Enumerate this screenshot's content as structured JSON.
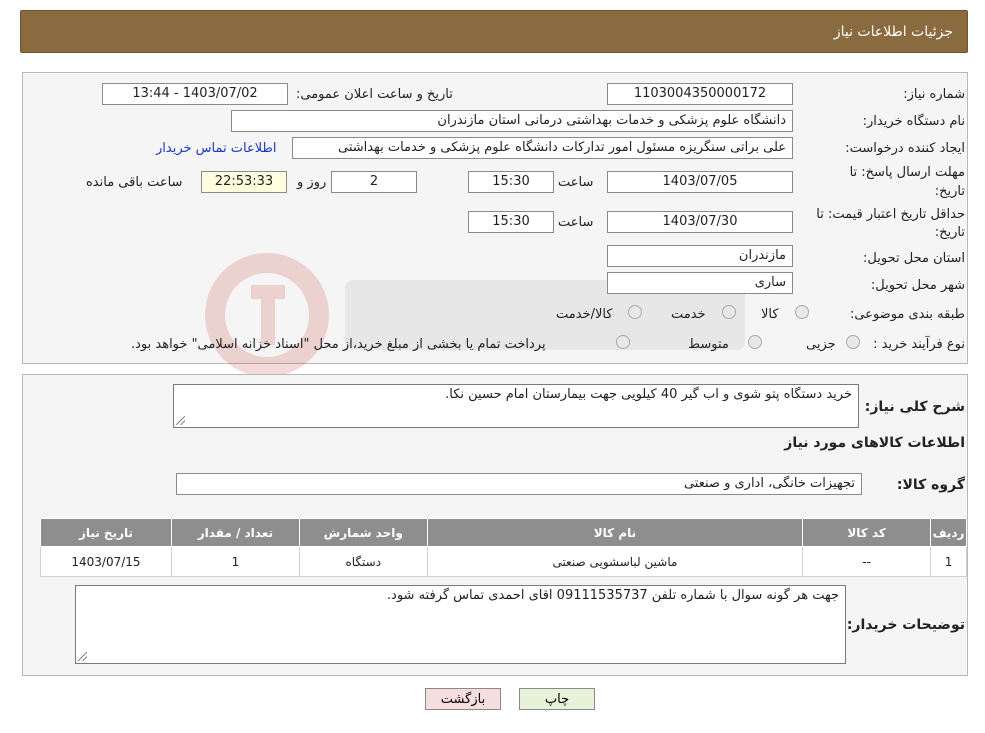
{
  "header": {
    "title": "جزئیات اطلاعات نیاز"
  },
  "form": {
    "need_number_label": "شماره نیاز:",
    "need_number": "1103004350000172",
    "announce_label": "تاریخ و ساعت اعلان عمومی:",
    "announce_value": "1403/07/02 - 13:44",
    "buyer_org_label": "نام دستگاه خریدار:",
    "buyer_org": "دانشگاه علوم پزشکی و خدمات بهداشتی  درمانی استان مازندران",
    "creator_label": "ایجاد کننده درخواست:",
    "creator": "علی براتی سنگریزه مسئول امور تدارکات دانشگاه علوم پزشکی و خدمات بهداشتی",
    "contact_link": "اطلاعات تماس خریدار",
    "deadline_label_1": "مهلت ارسال پاسخ: تا",
    "deadline_label_2": "تاریخ:",
    "deadline_date": "1403/07/05",
    "time_label": "ساعت",
    "deadline_time": "15:30",
    "days_value": "2",
    "days_label": "روز و",
    "remaining_time": "22:53:33",
    "remaining_label": "ساعت باقی مانده",
    "validity_label_1": "حداقل تاریخ اعتبار قیمت: تا",
    "validity_label_2": "تاریخ:",
    "validity_date": "1403/07/30",
    "validity_time": "15:30",
    "province_label": "استان محل تحویل:",
    "province": "مازندران",
    "city_label": "شهر محل تحویل:",
    "city": "ساری",
    "category_label": "طبقه بندی موضوعی:",
    "category_options": [
      "کالا",
      "خدمت",
      "کالا/خدمت"
    ],
    "process_label": "نوع فرآیند خرید :",
    "process_options": [
      "جزیی",
      "متوسط"
    ],
    "payment_note": "پرداخت تمام یا بخشی از مبلغ خرید،از محل \"اسناد خزانه اسلامی\" خواهد بود."
  },
  "details": {
    "summary_label": "شرح کلی نیاز:",
    "summary": "خرید دستگاه پتو شوی و اب گیر 40 کیلویی جهت بیمارستان امام حسین نکا.",
    "goods_info_title": "اطلاعات کالاهای مورد نیاز",
    "goods_group_label": "گروه کالا:",
    "goods_group": "تجهیزات خانگی، اداری و صنعتی",
    "table": {
      "headers": [
        "ردیف",
        "کد کالا",
        "نام کالا",
        "واحد شمارش",
        "تعداد / مقدار",
        "تاریخ نیاز"
      ],
      "rows": [
        [
          "1",
          "--",
          "ماشین لباسشویی صنعتی",
          "دستگاه",
          "1",
          "1403/07/15"
        ]
      ]
    },
    "buyer_notes_label": "توضیحات خریدار:",
    "buyer_notes": "جهت هر گونه سوال با شماره تلفن 09111535737 اقای احمدی تماس گرفته شود."
  },
  "buttons": {
    "print": "چاپ",
    "back": "بازگشت"
  },
  "colors": {
    "header_bg": "#8a6a3f",
    "table_header_bg": "#8e8e8e",
    "back_btn_bg": "#f7dede",
    "print_btn_bg": "#e6f3d8"
  }
}
